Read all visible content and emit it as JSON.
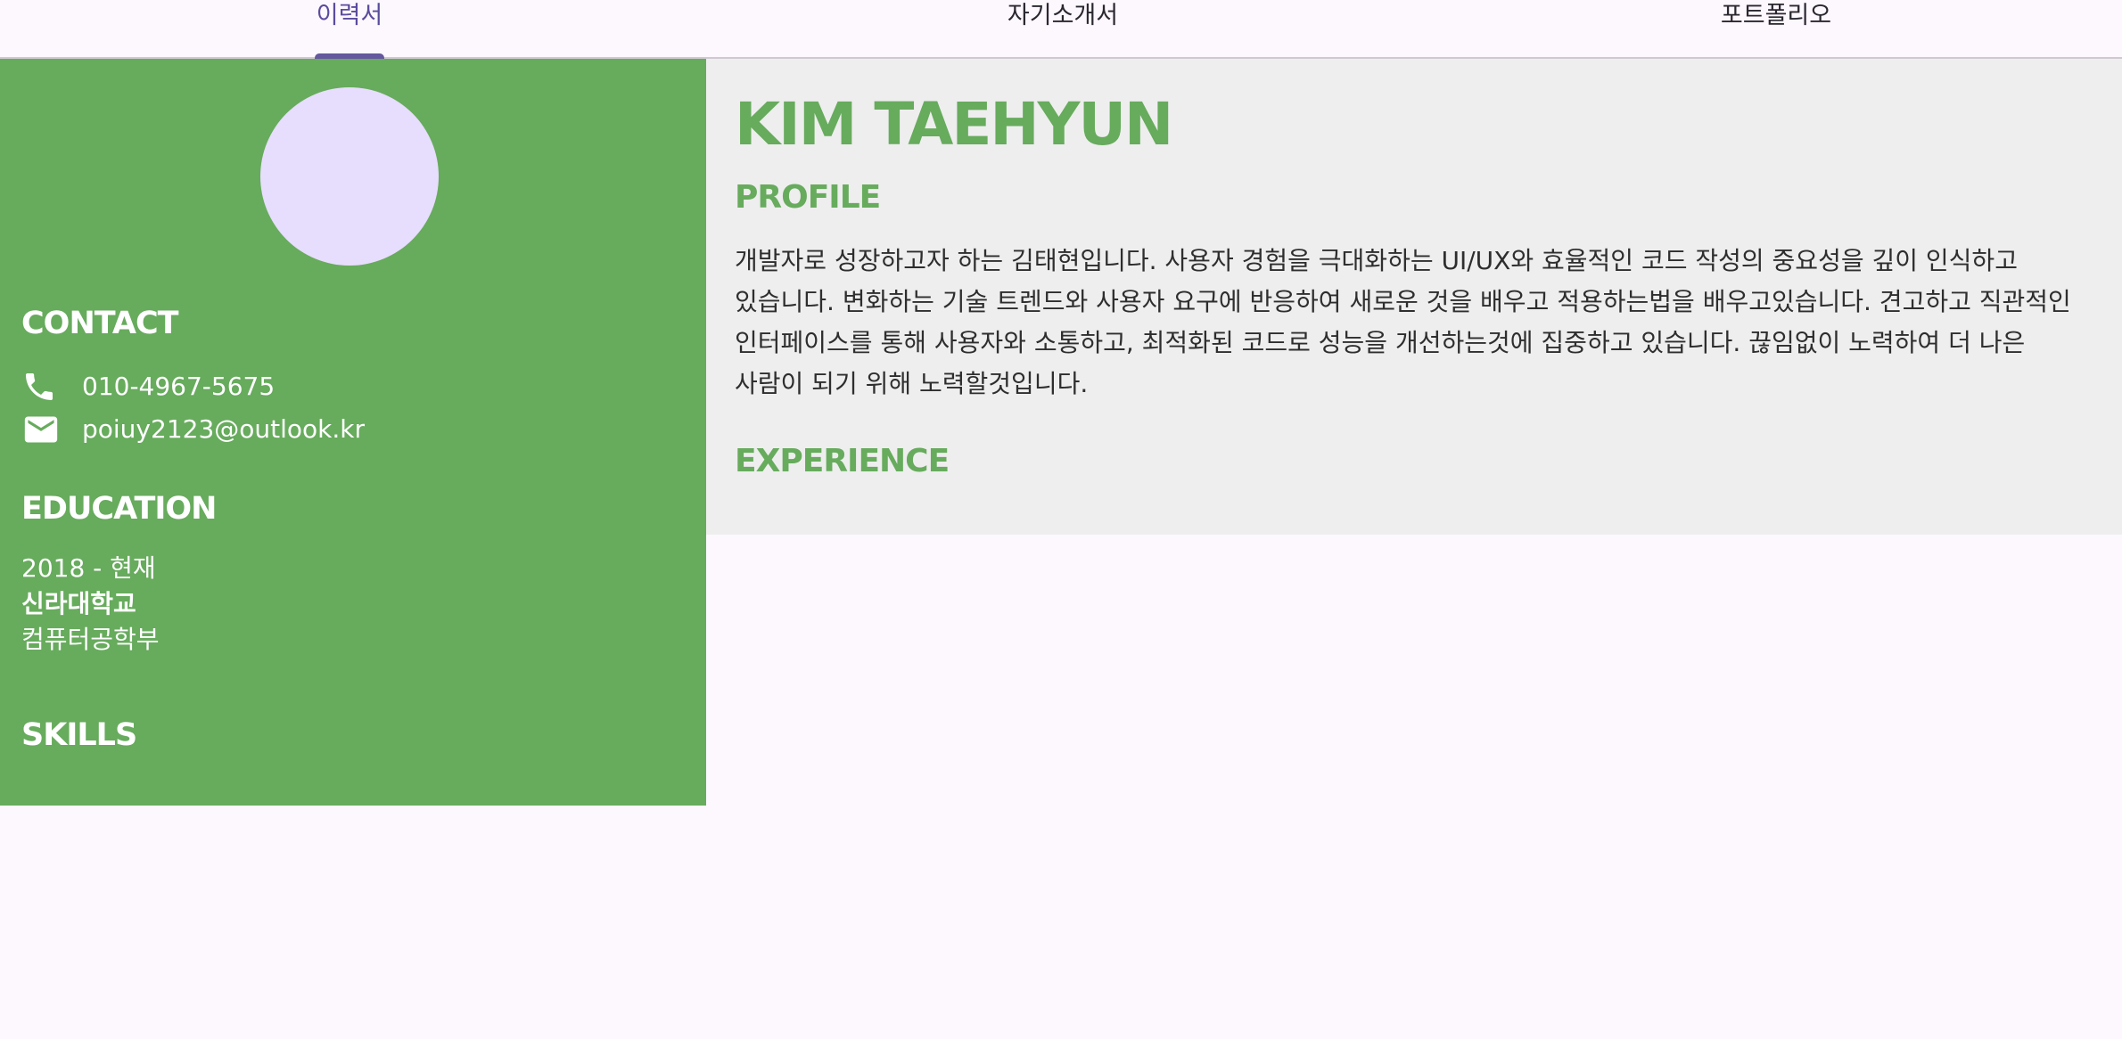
{
  "tabs": [
    {
      "label": "이력서",
      "active": true
    },
    {
      "label": "자기소개서",
      "active": false
    },
    {
      "label": "포트폴리오",
      "active": false
    }
  ],
  "colors": {
    "accent_green": "#67ab5d",
    "tab_indicator": "#65589f",
    "avatar_fill": "#e7ddfc",
    "main_bg": "#eeeeee"
  },
  "sidebar": {
    "contact_heading": "CONTACT",
    "phone_icon": "phone-icon",
    "phone": "010-4967-5675",
    "email_icon": "mail-icon",
    "email": "poiuy2123@outlook.kr",
    "education_heading": "EDUCATION",
    "education": {
      "period": "2018 - 현재",
      "school": "신라대학교",
      "major": "컴퓨터공학부"
    },
    "skills_heading": "SKILLS"
  },
  "main": {
    "name": "KIM TAEHYUN",
    "profile_heading": "PROFILE",
    "profile_text": "개발자로 성장하고자 하는 김태현입니다. 사용자 경험을 극대화하는 UI/UX와 효율적인 코드 작성의 중요성을 깊이 인식하고 있습니다. 변화하는 기술 트렌드와 사용자 요구에 반응하여 새로운 것을 배우고 적용하는법을 배우고있습니다. 견고하고 직관적인 인터페이스를 통해 사용자와 소통하고, 최적화된 코드로 성능을 개선하는것에 집중하고 있습니다. 끊임없이 노력하여 더 나은 사람이 되기 위해 노력할것입니다.",
    "experience_heading": "EXPERIENCE"
  }
}
